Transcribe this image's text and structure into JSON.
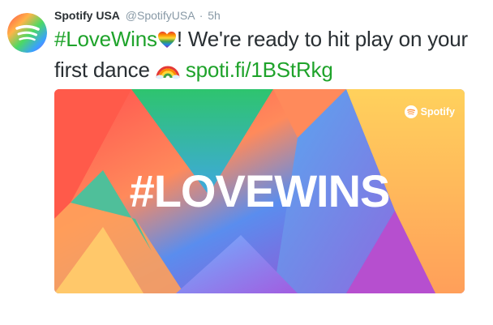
{
  "account": {
    "display_name": "Spotify USA",
    "handle": "@SpotifyUSA",
    "separator": "·",
    "time": "5h"
  },
  "tweet": {
    "hashtag": "#LoveWins",
    "text_after_hashtag": "! We're ready to hit play on your first dance",
    "link": "spoti.fi/1BStRkg"
  },
  "card": {
    "headline": "#LOVEWINS",
    "brand": "Spotify"
  },
  "icons": {
    "avatar": "spotify-logo-icon",
    "heart": "rainbow-heart-icon",
    "rainbow": "rainbow-icon",
    "brand": "spotify-logo-icon"
  },
  "colors": {
    "hashtag_link": "#1fa32b",
    "text": "#292f33",
    "meta": "#8899a6"
  }
}
